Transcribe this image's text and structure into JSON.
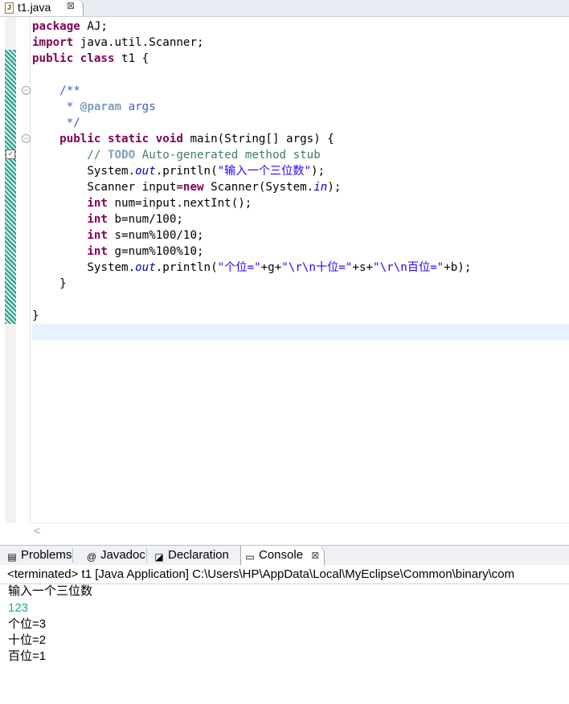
{
  "editor_tab": {
    "label": "t1.java",
    "close": "⊠",
    "file_icon": "J"
  },
  "code_lines": [
    [
      {
        "t": "package",
        "c": "kw"
      },
      {
        "t": " AJ;"
      }
    ],
    [
      {
        "t": "import",
        "c": "kw"
      },
      {
        "t": " java.util.Scanner;"
      }
    ],
    [
      {
        "t": "public",
        "c": "kw"
      },
      {
        "t": " "
      },
      {
        "t": "class",
        "c": "kw"
      },
      {
        "t": " t1 {"
      }
    ],
    [
      {
        "t": ""
      }
    ],
    [
      {
        "t": "    /**",
        "c": "cmt"
      }
    ],
    [
      {
        "t": "     * ",
        "c": "cmt"
      },
      {
        "t": "@param",
        "c": "tag"
      },
      {
        "t": " args",
        "c": "cmt"
      }
    ],
    [
      {
        "t": "     */",
        "c": "cmt"
      }
    ],
    [
      {
        "t": "    "
      },
      {
        "t": "public",
        "c": "kw"
      },
      {
        "t": " "
      },
      {
        "t": "static",
        "c": "kw"
      },
      {
        "t": " "
      },
      {
        "t": "void",
        "c": "kw"
      },
      {
        "t": " main(String[] args) {"
      }
    ],
    [
      {
        "t": "        // ",
        "c": "lc"
      },
      {
        "t": "TODO",
        "c": "todo"
      },
      {
        "t": " Auto-generated method stub",
        "c": "lc"
      }
    ],
    [
      {
        "t": "        System."
      },
      {
        "t": "out",
        "c": "it"
      },
      {
        "t": ".println("
      },
      {
        "t": "\"输入一个三位数\"",
        "c": "str"
      },
      {
        "t": ");"
      }
    ],
    [
      {
        "t": "        Scanner input="
      },
      {
        "t": "new",
        "c": "kw"
      },
      {
        "t": " Scanner(System."
      },
      {
        "t": "in",
        "c": "it"
      },
      {
        "t": ");"
      }
    ],
    [
      {
        "t": "        "
      },
      {
        "t": "int",
        "c": "kw"
      },
      {
        "t": " num=input.nextInt();"
      }
    ],
    [
      {
        "t": "        "
      },
      {
        "t": "int",
        "c": "kw"
      },
      {
        "t": " b=num/100;"
      }
    ],
    [
      {
        "t": "        "
      },
      {
        "t": "int",
        "c": "kw"
      },
      {
        "t": " s=num%100/10;"
      }
    ],
    [
      {
        "t": "        "
      },
      {
        "t": "int",
        "c": "kw"
      },
      {
        "t": " g=num%100%10;"
      }
    ],
    [
      {
        "t": "        System."
      },
      {
        "t": "out",
        "c": "it"
      },
      {
        "t": ".println("
      },
      {
        "t": "\"个位=\"",
        "c": "str"
      },
      {
        "t": "+g+"
      },
      {
        "t": "\"\\r\\n十位=\"",
        "c": "str"
      },
      {
        "t": "+s+"
      },
      {
        "t": "\"\\r\\n百位=\"",
        "c": "str"
      },
      {
        "t": "+b);"
      }
    ],
    [
      {
        "t": "    }"
      }
    ],
    [
      {
        "t": ""
      }
    ],
    [
      {
        "t": "}"
      }
    ]
  ],
  "panel_tabs": [
    {
      "label": "Problems",
      "icon": "problems-icon"
    },
    {
      "label": "Javadoc",
      "icon": "javadoc-icon"
    },
    {
      "label": "Declaration",
      "icon": "declaration-icon"
    },
    {
      "label": "Console",
      "icon": "console-icon",
      "close": "⊠"
    }
  ],
  "console": {
    "header": "<terminated> t1 [Java Application] C:\\Users\\HP\\AppData\\Local\\MyEclipse\\Common\\binary\\com",
    "lines": [
      {
        "text": "输入一个三位数",
        "kind": "output"
      },
      {
        "text": "123",
        "kind": "input"
      },
      {
        "text": "个位=3",
        "kind": "output"
      },
      {
        "text": "十位=2",
        "kind": "output"
      },
      {
        "text": "百位=1",
        "kind": "output"
      }
    ]
  },
  "colors": {
    "keyword": "#7f0055",
    "javadoc": "#3f5fbf",
    "comment": "#3f7f5f",
    "string": "#2a00ff",
    "field": "#0000c0",
    "console_input": "#1eaa8c",
    "current_line": "#e8f2fe"
  }
}
